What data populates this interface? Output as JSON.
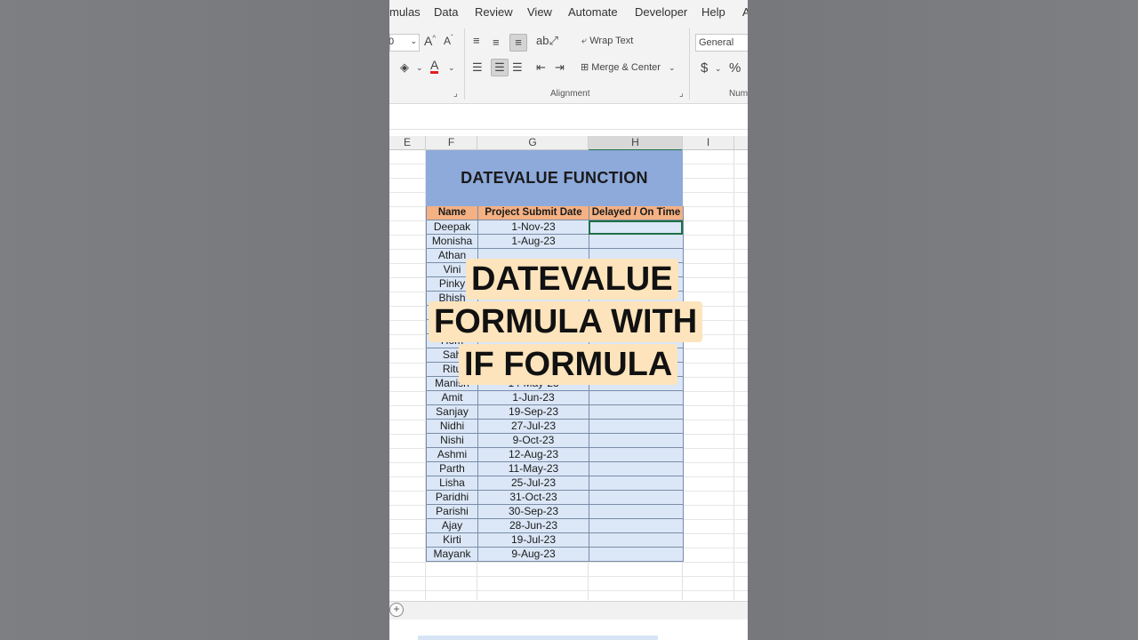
{
  "ribbon": {
    "tabs": [
      "mulas",
      "Data",
      "Review",
      "View",
      "Automate",
      "Developer",
      "Help",
      "A"
    ],
    "font_size": "0",
    "wrap_text": "Wrap Text",
    "merge_center": "Merge & Center",
    "alignment_label": "Alignment",
    "number_format": "General",
    "dollar": "$",
    "percent": "%",
    "number_label": "Num"
  },
  "columns": [
    "E",
    "F",
    "G",
    "H",
    "I"
  ],
  "selected_column": "H",
  "sheet_title": "DATEVALUE FUNCTION",
  "table": {
    "headers": [
      "Name",
      "Project Submit Date",
      "Delayed / On Time"
    ],
    "rows": [
      [
        "Deepak",
        "1-Nov-23",
        ""
      ],
      [
        "Monisha",
        "1-Aug-23",
        ""
      ],
      [
        "Athan",
        "",
        ""
      ],
      [
        "Vini",
        "",
        ""
      ],
      [
        "Pinky",
        "",
        ""
      ],
      [
        "Bhish",
        "",
        ""
      ],
      [
        "",
        "",
        ""
      ],
      [
        "",
        "",
        ""
      ],
      [
        "Hom",
        "",
        ""
      ],
      [
        "Sah",
        "",
        ""
      ],
      [
        "Ritu",
        "",
        ""
      ],
      [
        "Manish",
        "14-May-23",
        ""
      ],
      [
        "Amit",
        "1-Jun-23",
        ""
      ],
      [
        "Sanjay",
        "19-Sep-23",
        ""
      ],
      [
        "Nidhi",
        "27-Jul-23",
        ""
      ],
      [
        "Nishi",
        "9-Oct-23",
        ""
      ],
      [
        "Ashmi",
        "12-Aug-23",
        ""
      ],
      [
        "Parth",
        "11-May-23",
        ""
      ],
      [
        "Lisha",
        "25-Jul-23",
        ""
      ],
      [
        "Paridhi",
        "31-Oct-23",
        ""
      ],
      [
        "Parishi",
        "30-Sep-23",
        ""
      ],
      [
        "Ajay",
        "28-Jun-23",
        ""
      ],
      [
        "Kirti",
        "19-Jul-23",
        ""
      ],
      [
        "Mayank",
        "9-Aug-23",
        ""
      ]
    ]
  },
  "overlay_caption": [
    "DATEVALUE",
    "FORMULA WITH",
    "IF FORMULA"
  ],
  "colors": {
    "title_fill": "#8eaadb",
    "header_fill": "#f4b183",
    "body_fill": "#dbe7f7",
    "caption_bg": "#fde4bd",
    "selection": "#1e7145"
  }
}
